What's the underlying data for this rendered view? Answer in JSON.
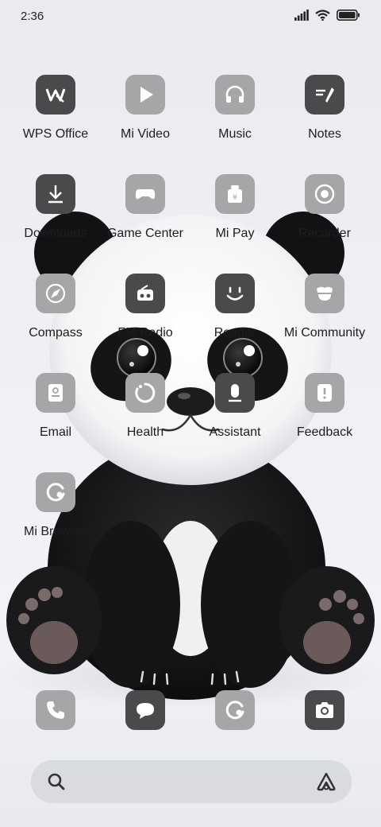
{
  "status_bar": {
    "time": "2:36"
  },
  "apps": [
    {
      "label": "WPS Office",
      "icon": "wps-office-icon"
    },
    {
      "label": "Mi Video",
      "icon": "play-icon"
    },
    {
      "label": "Music",
      "icon": "headphones-icon"
    },
    {
      "label": "Notes",
      "icon": "notes-pen-icon"
    },
    {
      "label": "Downloads",
      "icon": "download-icon"
    },
    {
      "label": "Game Center",
      "icon": "gamepad-icon"
    },
    {
      "label": "Mi Pay",
      "icon": "wallet-icon"
    },
    {
      "label": "Recorder",
      "icon": "record-icon"
    },
    {
      "label": "Compass",
      "icon": "compass-icon"
    },
    {
      "label": "FM Radio",
      "icon": "radio-icon"
    },
    {
      "label": "Reader",
      "icon": "smile-icon"
    },
    {
      "label": "Mi Community",
      "icon": "community-icon"
    },
    {
      "label": "Email",
      "icon": "email-icon"
    },
    {
      "label": "Health",
      "icon": "health-ring-icon"
    },
    {
      "label": "Assistant",
      "icon": "assistant-icon"
    },
    {
      "label": "Feedback",
      "icon": "feedback-icon"
    },
    {
      "label": "Mi Browser",
      "icon": "browser-icon"
    }
  ],
  "dock": [
    {
      "icon": "phone-icon"
    },
    {
      "icon": "messages-icon"
    },
    {
      "icon": "browser-icon"
    },
    {
      "icon": "camera-icon"
    }
  ]
}
